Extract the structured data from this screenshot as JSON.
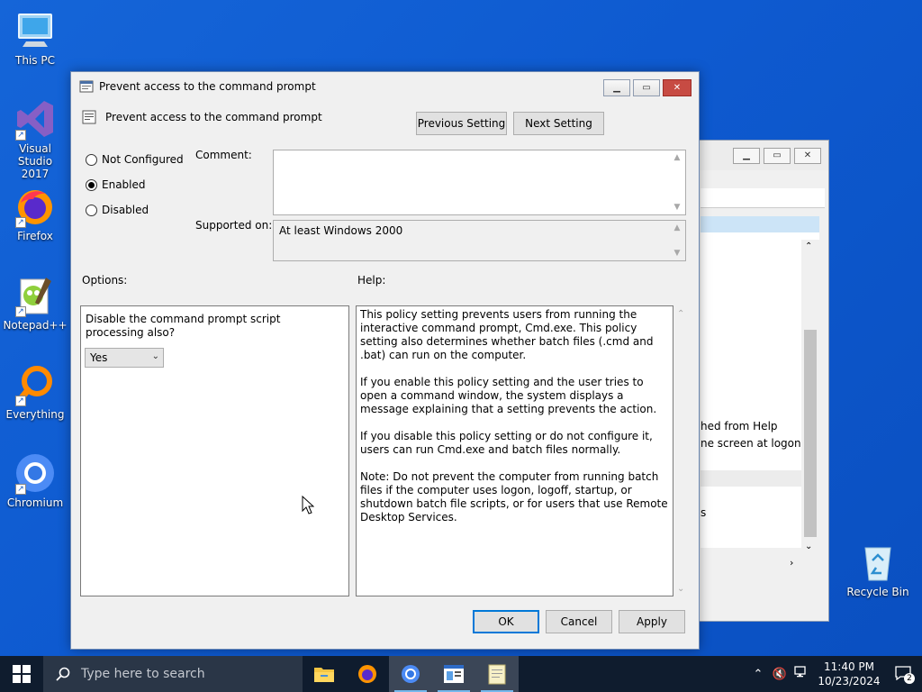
{
  "desktop": {
    "icons": [
      {
        "label": "This PC"
      },
      {
        "label": "Visual Studio 2017"
      },
      {
        "label": "Firefox"
      },
      {
        "label": "Notepad++"
      },
      {
        "label": "Everything"
      },
      {
        "label": "Chromium"
      },
      {
        "label": "Recycle Bin"
      }
    ]
  },
  "background_window": {
    "line1": "hed from Help",
    "line2": "ne screen at logon",
    "line3": "s"
  },
  "dialog": {
    "title": "Prevent access to the command prompt",
    "policy_name": "Prevent access to the command prompt",
    "prev_label": "Previous Setting",
    "next_label": "Next Setting",
    "radios": [
      {
        "label": "Not Configured",
        "selected": false
      },
      {
        "label": "Enabled",
        "selected": true
      },
      {
        "label": "Disabled",
        "selected": false
      }
    ],
    "comment_label": "Comment:",
    "comment_value": "",
    "supported_label": "Supported on:",
    "supported_value": "At least Windows 2000",
    "options_label": "Options:",
    "help_label": "Help:",
    "option_text": "Disable the command prompt script processing also?",
    "option_value": "Yes",
    "help": [
      "This policy setting prevents users from running the interactive command prompt, Cmd.exe.  This policy setting also determines whether batch files (.cmd and .bat) can run on the computer.",
      "If you enable this policy setting and the user tries to open a command window, the system displays a message explaining that a setting prevents the action.",
      "If you disable this policy setting or do not configure it, users can run Cmd.exe and batch files normally.",
      "Note: Do not prevent the computer from running batch files if the computer uses logon, logoff, startup, or shutdown batch file scripts, or for users that use Remote Desktop Services."
    ],
    "ok_label": "OK",
    "cancel_label": "Cancel",
    "apply_label": "Apply"
  },
  "taskbar": {
    "search_placeholder": "Type here to search",
    "time": "11:40 PM",
    "date": "10/23/2024",
    "notification_count": "2",
    "apps": [
      "file-explorer",
      "firefox",
      "chromium",
      "group-policy-editor",
      "notepad"
    ]
  },
  "colors": {
    "desktop_bg": "#0e5ad0",
    "taskbar_bg": "#0f1c2e",
    "accent": "#0078d7",
    "close_button": "#c74b43"
  }
}
